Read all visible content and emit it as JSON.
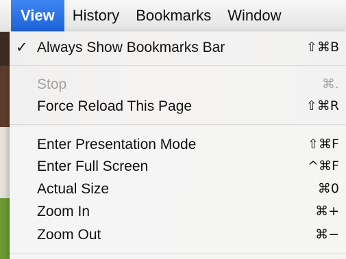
{
  "menubar": {
    "items": [
      {
        "label": "View",
        "active": true
      },
      {
        "label": "History"
      },
      {
        "label": "Bookmarks"
      },
      {
        "label": "Window"
      }
    ]
  },
  "view_menu": {
    "items": [
      {
        "label": "Always Show Bookmarks Bar",
        "shortcut": "⇧⌘B",
        "checked": true,
        "check": "✓"
      },
      {
        "label": "Stop",
        "shortcut": "⌘.",
        "disabled": true
      },
      {
        "label": "Force Reload This Page",
        "shortcut": "⇧⌘R"
      },
      {
        "label": "Enter Presentation Mode",
        "shortcut": "⇧⌘F"
      },
      {
        "label": "Enter Full Screen",
        "shortcut": "^⌘F"
      },
      {
        "label": "Actual Size",
        "shortcut": "⌘0"
      },
      {
        "label": "Zoom In",
        "shortcut": "⌘+"
      },
      {
        "label": "Zoom Out",
        "shortcut": "⌘−"
      }
    ]
  },
  "colors": {
    "highlight": "#1c63d8",
    "disabled_text": "#a3a3a3"
  }
}
